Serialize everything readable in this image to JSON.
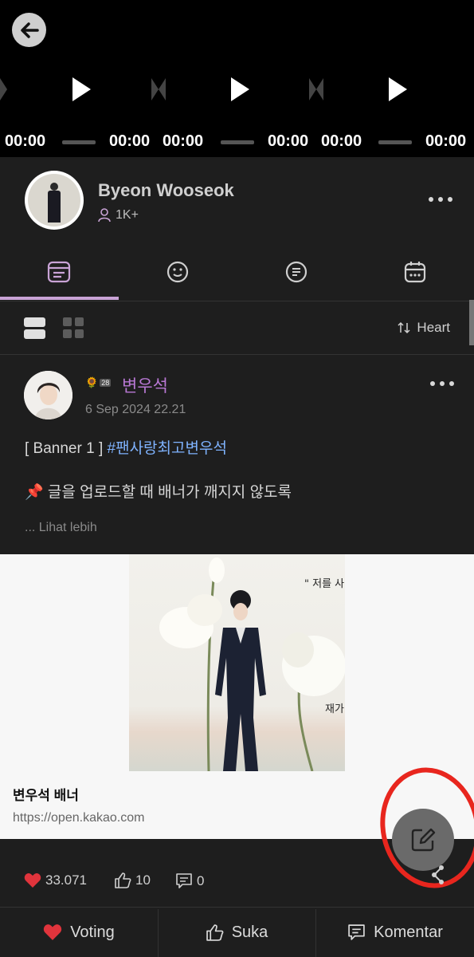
{
  "video": {
    "times": [
      "00:00",
      "00:00",
      "00:00",
      "00:00",
      "00:00",
      "00:00"
    ]
  },
  "profile": {
    "name": "Byeon Wooseok",
    "members": "1K+"
  },
  "tabs": [
    {
      "icon": "feed-icon",
      "active": true
    },
    {
      "icon": "smiley-icon",
      "active": false
    },
    {
      "icon": "chat-list-icon",
      "active": false
    },
    {
      "icon": "calendar-icon",
      "active": false
    }
  ],
  "toolbar": {
    "sort_label": "Heart"
  },
  "post": {
    "badge_level": "28",
    "author": "변우석",
    "date": "6 Sep 2024 22.21",
    "title_prefix": "[ Banner 1 ] ",
    "hashtag": "#팬사랑최고변우석",
    "body": "📌 글을 업로드할 때 배너가 깨지지 않도록",
    "see_more": "... Lihat lebih",
    "preview": {
      "image_text_1": "\" 저를 사",
      "image_text_2": "재가",
      "title": "변우석 배너",
      "url": "https://open.kakao.com"
    }
  },
  "stats": {
    "hearts": "33.071",
    "likes": "10",
    "comments": "0"
  },
  "actions": {
    "voting": "Voting",
    "like": "Suka",
    "comment": "Komentar"
  },
  "colors": {
    "accent": "#c9a3d6",
    "author": "#b878d4",
    "hashtag": "#7fb3ff",
    "heart": "#e0343c",
    "annotation": "#e8261e"
  }
}
